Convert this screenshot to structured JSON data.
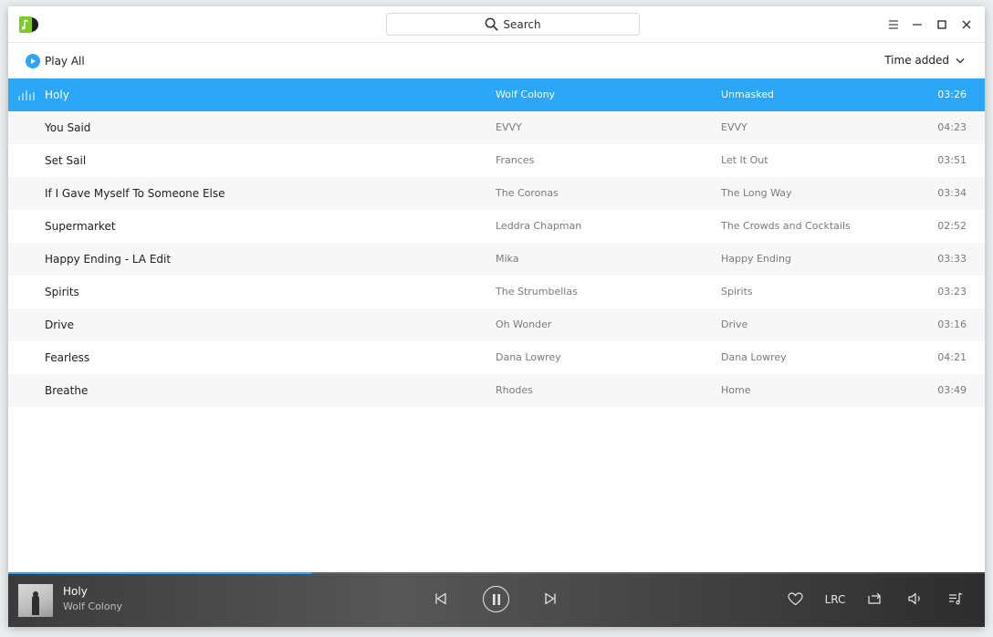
{
  "titlebar": {
    "search_label": "Search"
  },
  "toolbar": {
    "play_all_label": "Play All",
    "sort_label": "Time added"
  },
  "songs": [
    {
      "title": "Holy",
      "artist": "Wolf Colony",
      "album": "Unmasked",
      "duration": "03:26",
      "playing": true
    },
    {
      "title": "You Said",
      "artist": "EVVY",
      "album": "EVVY",
      "duration": "04:23"
    },
    {
      "title": "Set Sail",
      "artist": "Frances",
      "album": "Let It Out",
      "duration": "03:51"
    },
    {
      "title": "If I Gave Myself To Someone Else",
      "artist": "The Coronas",
      "album": "The Long Way",
      "duration": "03:34"
    },
    {
      "title": "Supermarket",
      "artist": "Leddra Chapman",
      "album": "The Crowds and Cocktails",
      "duration": "02:52"
    },
    {
      "title": "Happy Ending - LA Edit",
      "artist": "Mika",
      "album": "Happy Ending",
      "duration": "03:33"
    },
    {
      "title": "Spirits",
      "artist": "The Strumbellas",
      "album": "Spirits",
      "duration": "03:23"
    },
    {
      "title": "Drive",
      "artist": "Oh Wonder",
      "album": "Drive",
      "duration": "03:16"
    },
    {
      "title": "Fearless",
      "artist": "Dana Lowrey",
      "album": "Dana Lowrey",
      "duration": "04:21"
    },
    {
      "title": "Breathe",
      "artist": "Rhodes",
      "album": "Home",
      "duration": "03:49"
    }
  ],
  "player": {
    "title": "Holy",
    "artist": "Wolf Colony",
    "progress": 0.31,
    "lrc_label": "LRC"
  },
  "colors": {
    "accent": "#2ca7f8",
    "logo_green": "#7ec92b"
  }
}
